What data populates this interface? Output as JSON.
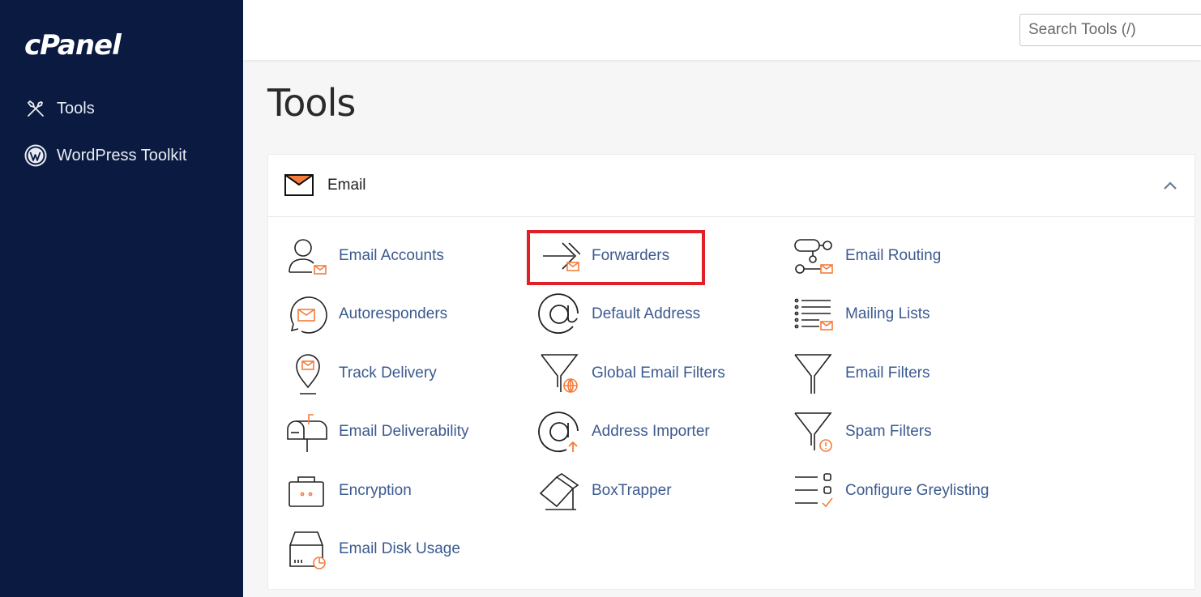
{
  "sidebar": {
    "logo": "cPanel",
    "items": [
      {
        "label": "Tools",
        "icon": "tools-icon"
      },
      {
        "label": "WordPress Toolkit",
        "icon": "wordpress-icon"
      }
    ]
  },
  "header": {
    "search_placeholder": "Search Tools (/)"
  },
  "page": {
    "title": "Tools"
  },
  "email_section": {
    "title": "Email",
    "icon": "envelope-icon",
    "tools": [
      {
        "label": "Email Accounts",
        "icon": "user-mail-icon"
      },
      {
        "label": "Forwarders",
        "icon": "forward-arrow-icon"
      },
      {
        "label": "Email Routing",
        "icon": "routing-icon"
      },
      {
        "label": "Autoresponders",
        "icon": "autoresponder-icon"
      },
      {
        "label": "Default Address",
        "icon": "at-sign-icon"
      },
      {
        "label": "Mailing Lists",
        "icon": "list-mail-icon"
      },
      {
        "label": "Track Delivery",
        "icon": "map-pin-mail-icon"
      },
      {
        "label": "Global Email Filters",
        "icon": "funnel-globe-icon"
      },
      {
        "label": "Email Filters",
        "icon": "funnel-icon"
      },
      {
        "label": "Email Deliverability",
        "icon": "mailbox-icon"
      },
      {
        "label": "Address Importer",
        "icon": "at-import-icon"
      },
      {
        "label": "Spam Filters",
        "icon": "funnel-warning-icon"
      },
      {
        "label": "Encryption",
        "icon": "encryption-box-icon"
      },
      {
        "label": "BoxTrapper",
        "icon": "boxtrapper-icon"
      },
      {
        "label": "Configure Greylisting",
        "icon": "checklist-icon"
      },
      {
        "label": "Email Disk Usage",
        "icon": "disk-usage-icon"
      }
    ]
  },
  "colors": {
    "sidebar_bg": "#0b1a40",
    "link": "#3b5a8f",
    "accent": "#f47c3c",
    "highlight": "#e01f26"
  }
}
